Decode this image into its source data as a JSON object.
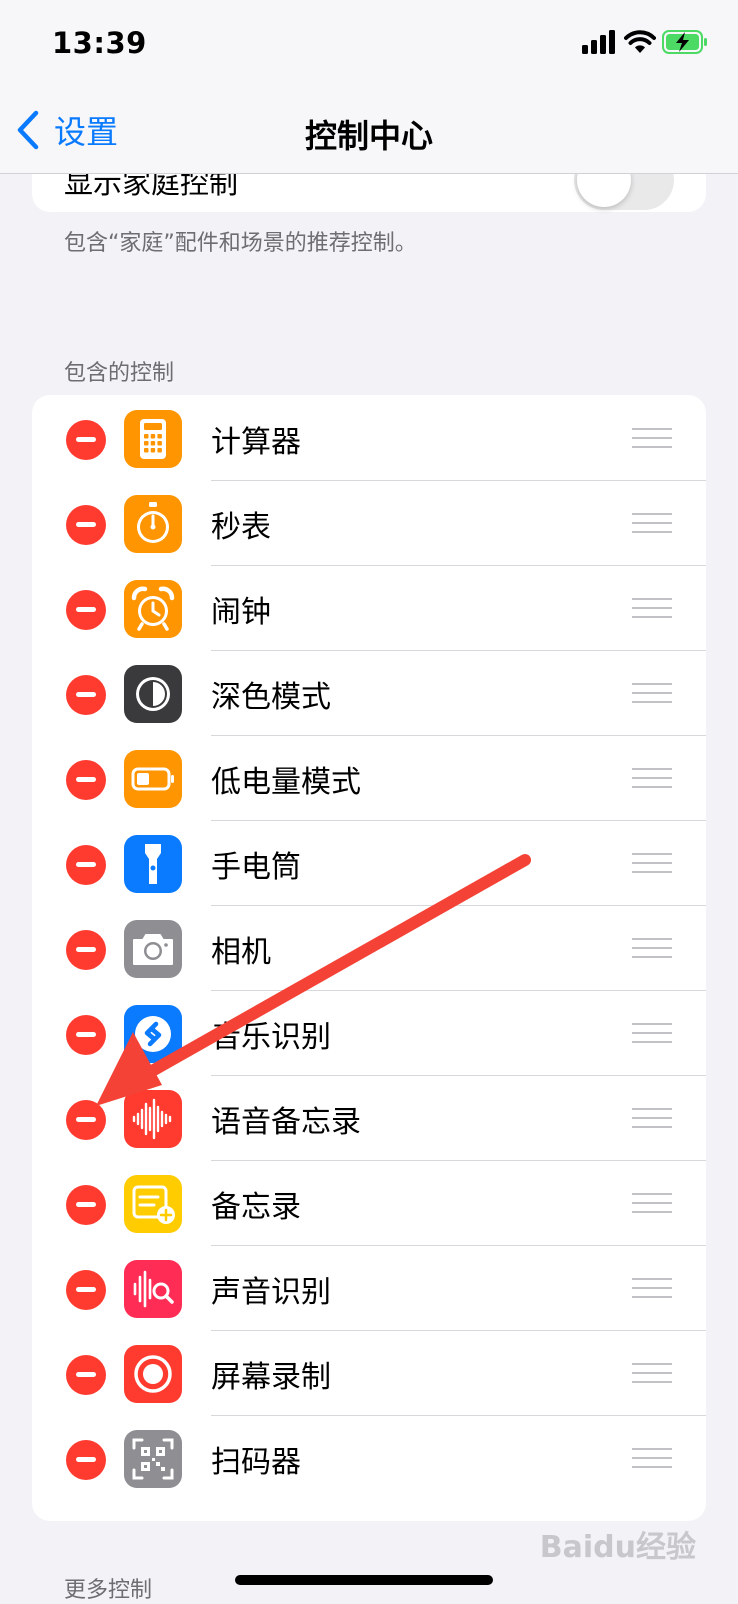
{
  "status_bar": {
    "time": "13:39"
  },
  "nav": {
    "back_label": "设置",
    "title": "控制中心"
  },
  "top_card": {
    "label": "显示家庭控制",
    "toggle_on": false
  },
  "footer_note": "包含“家庭”配件和场景的推荐控制。",
  "included_section": {
    "header": "包含的控制",
    "items": [
      {
        "label": "计算器",
        "icon": "calculator-icon",
        "color": "#ff9500"
      },
      {
        "label": "秒表",
        "icon": "stopwatch-icon",
        "color": "#ff9500"
      },
      {
        "label": "闹钟",
        "icon": "alarm-icon",
        "color": "#ff9500"
      },
      {
        "label": "深色模式",
        "icon": "dark-mode-icon",
        "color": "#3a3a3c"
      },
      {
        "label": "低电量模式",
        "icon": "low-power-icon",
        "color": "#ff9500"
      },
      {
        "label": "手电筒",
        "icon": "flashlight-icon",
        "color": "#0a7aff"
      },
      {
        "label": "相机",
        "icon": "camera-icon",
        "color": "#8e8e93"
      },
      {
        "label": "音乐识别",
        "icon": "shazam-icon",
        "color": "#0a7aff"
      },
      {
        "label": "语音备忘录",
        "icon": "voice-memo-icon",
        "color": "#ff3b30"
      },
      {
        "label": "备忘录",
        "icon": "notes-icon",
        "color": "#ffcc00"
      },
      {
        "label": "声音识别",
        "icon": "sound-recognition-icon",
        "color": "#ff2d55"
      },
      {
        "label": "屏幕录制",
        "icon": "screen-record-icon",
        "color": "#ff3b30"
      },
      {
        "label": "扫码器",
        "icon": "qr-scanner-icon",
        "color": "#8e8e93"
      }
    ]
  },
  "more_section": {
    "header": "更多控制"
  },
  "watermark": "Baidu经验"
}
